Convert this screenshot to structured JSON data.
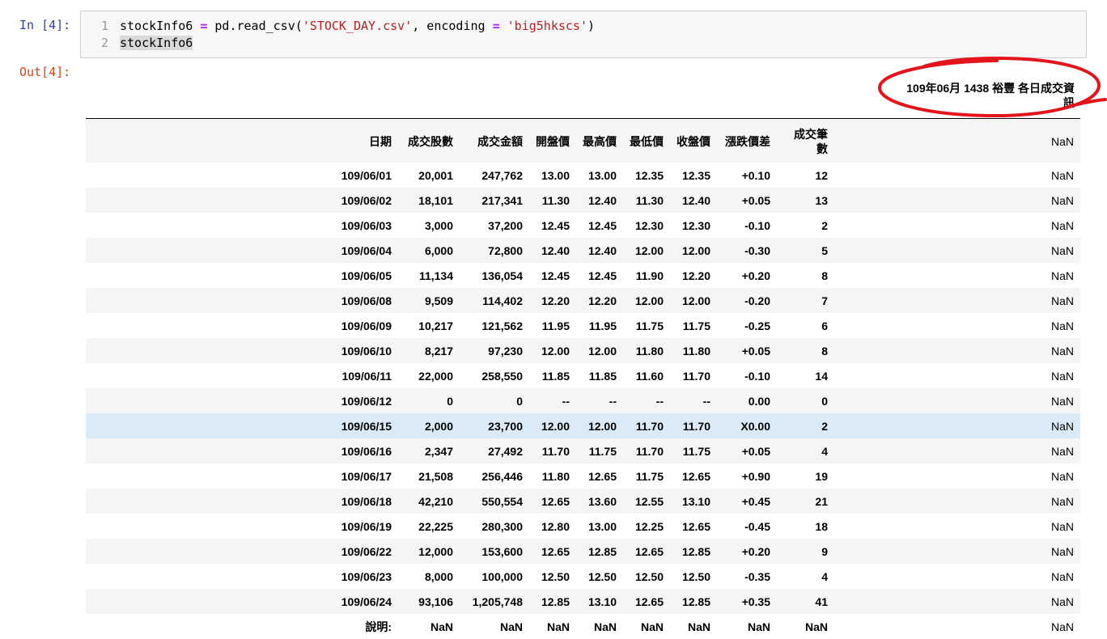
{
  "notebook": {
    "in_prompt": "In [4]:",
    "out_prompt": "Out[4]:",
    "code": {
      "line1_no": "1",
      "line2_no": "2",
      "l1_var": "stockInfo6 ",
      "l1_eq": "=",
      "l1_call": " pd.read_csv(",
      "l1_file": "'STOCK_DAY.csv'",
      "l1_mid": ", encoding ",
      "l1_eq2": "=",
      "l1_sp": " ",
      "l1_enc": "'big5hkscs'",
      "l1_end": ")",
      "line2": "stockInfo6"
    }
  },
  "dataframe": {
    "title": "109年06月 1438 裕豐 各日成交資訊",
    "columns": [
      "日期",
      "成交股數",
      "成交金額",
      "開盤價",
      "最高價",
      "最低價",
      "收盤價",
      "漲跌價差",
      "成交筆數"
    ],
    "nan_header": "NaN",
    "rows": [
      [
        "109/06/01",
        "20,001",
        "247,762",
        "13.00",
        "13.00",
        "12.35",
        "12.35",
        "+0.10",
        "12",
        "NaN"
      ],
      [
        "109/06/02",
        "18,101",
        "217,341",
        "11.30",
        "12.40",
        "11.30",
        "12.40",
        "+0.05",
        "13",
        "NaN"
      ],
      [
        "109/06/03",
        "3,000",
        "37,200",
        "12.45",
        "12.45",
        "12.30",
        "12.30",
        "-0.10",
        "2",
        "NaN"
      ],
      [
        "109/06/04",
        "6,000",
        "72,800",
        "12.40",
        "12.40",
        "12.00",
        "12.00",
        "-0.30",
        "5",
        "NaN"
      ],
      [
        "109/06/05",
        "11,134",
        "136,054",
        "12.45",
        "12.45",
        "11.90",
        "12.20",
        "+0.20",
        "8",
        "NaN"
      ],
      [
        "109/06/08",
        "9,509",
        "114,402",
        "12.20",
        "12.20",
        "12.00",
        "12.00",
        "-0.20",
        "7",
        "NaN"
      ],
      [
        "109/06/09",
        "10,217",
        "121,562",
        "11.95",
        "11.95",
        "11.75",
        "11.75",
        "-0.25",
        "6",
        "NaN"
      ],
      [
        "109/06/10",
        "8,217",
        "97,230",
        "12.00",
        "12.00",
        "11.80",
        "11.80",
        "+0.05",
        "8",
        "NaN"
      ],
      [
        "109/06/11",
        "22,000",
        "258,550",
        "11.85",
        "11.85",
        "11.60",
        "11.70",
        "-0.10",
        "14",
        "NaN"
      ],
      [
        "109/06/12",
        "0",
        "0",
        "--",
        "--",
        "--",
        "--",
        "0.00",
        "0",
        "NaN"
      ],
      [
        "109/06/15",
        "2,000",
        "23,700",
        "12.00",
        "12.00",
        "11.70",
        "11.70",
        "X0.00",
        "2",
        "NaN"
      ],
      [
        "109/06/16",
        "2,347",
        "27,492",
        "11.70",
        "11.75",
        "11.70",
        "11.75",
        "+0.05",
        "4",
        "NaN"
      ],
      [
        "109/06/17",
        "21,508",
        "256,446",
        "11.80",
        "12.65",
        "11.75",
        "12.65",
        "+0.90",
        "19",
        "NaN"
      ],
      [
        "109/06/18",
        "42,210",
        "550,554",
        "12.65",
        "13.60",
        "12.55",
        "13.10",
        "+0.45",
        "21",
        "NaN"
      ],
      [
        "109/06/19",
        "22,225",
        "280,300",
        "12.80",
        "13.00",
        "12.25",
        "12.65",
        "-0.45",
        "18",
        "NaN"
      ],
      [
        "109/06/22",
        "12,000",
        "153,600",
        "12.65",
        "12.85",
        "12.65",
        "12.85",
        "+0.20",
        "9",
        "NaN"
      ],
      [
        "109/06/23",
        "8,000",
        "100,000",
        "12.50",
        "12.50",
        "12.50",
        "12.50",
        "-0.35",
        "4",
        "NaN"
      ],
      [
        "109/06/24",
        "93,106",
        "1,205,748",
        "12.85",
        "13.10",
        "12.65",
        "12.85",
        "+0.35",
        "41",
        "NaN"
      ],
      [
        "說明:",
        "NaN",
        "NaN",
        "NaN",
        "NaN",
        "NaN",
        "NaN",
        "NaN",
        "NaN",
        "NaN"
      ]
    ],
    "highlighted_row": 10
  },
  "annotation": {
    "color": "#e3141b"
  }
}
